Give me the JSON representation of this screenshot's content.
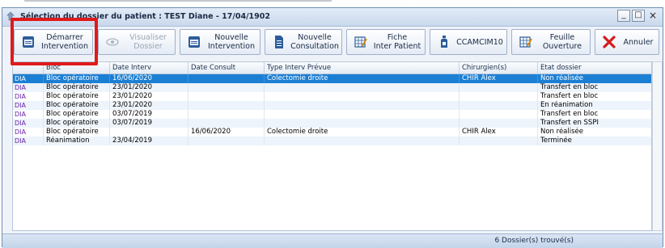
{
  "window": {
    "title": "Sélection du dossier du patient : TEST Diane - 17/04/1902",
    "minimize_label": "_",
    "maximize_label": "□",
    "close_label": "×"
  },
  "toolbar": {
    "buttons": [
      {
        "label": "Démarrer\nIntervention",
        "icon": "calendar-document-icon",
        "enabled": true
      },
      {
        "label": "Visualiser\nDossier",
        "icon": "eye-icon",
        "enabled": false
      },
      {
        "label": "Nouvelle\nIntervention",
        "icon": "calendar-document-icon",
        "enabled": true
      },
      {
        "label": "Nouvelle\nConsultation",
        "icon": "document-icon",
        "enabled": true
      },
      {
        "label": "Fiche\nInter Patient",
        "icon": "grid-pen-icon",
        "enabled": true
      },
      {
        "label": "CCAMCIM10",
        "icon": "bottle-icon",
        "enabled": true
      },
      {
        "label": "Feuille\nOuverture",
        "icon": "grid-pen-icon",
        "enabled": true
      },
      {
        "label": "Annuler",
        "icon": "red-x-icon",
        "enabled": true
      }
    ]
  },
  "table": {
    "columns": [
      "",
      "Bloc",
      "Date Interv",
      "Date Consult",
      "Type Interv Prévue",
      "Chirurgien(s)",
      "Etat dossier"
    ],
    "rows": [
      [
        "DIA",
        "Bloc opératoire",
        "16/06/2020",
        "",
        "Colectomie droite",
        "CHIR Alex",
        "Non réalisée"
      ],
      [
        "DIA",
        "Bloc opératoire",
        "23/01/2020",
        "",
        "",
        "",
        "Transfert en bloc"
      ],
      [
        "DIA",
        "Bloc opératoire",
        "23/01/2020",
        "",
        "",
        "",
        "Transfert en bloc"
      ],
      [
        "DIA",
        "Bloc opératoire",
        "23/01/2020",
        "",
        "",
        "",
        "En réanimation"
      ],
      [
        "DIA",
        "Bloc opératoire",
        "03/07/2019",
        "",
        "",
        "",
        "Transfert en bloc"
      ],
      [
        "DIA",
        "Bloc opératoire",
        "03/07/2019",
        "",
        "",
        "",
        "Transfert en SSPI"
      ],
      [
        "DIA",
        "Bloc opératoire",
        "",
        "16/06/2020",
        "Colectomie droite",
        "CHIR Alex",
        "Non réalisée"
      ],
      [
        "DIA",
        "Réanimation",
        "23/04/2019",
        "",
        "",
        "",
        "Terminée"
      ]
    ],
    "selected_row": 0
  },
  "status": {
    "text": "6 Dossier(s) trouvé(s)"
  },
  "colors": {
    "selection": "#1b7fd4",
    "highlight": "#e11a1a",
    "tag": "#6b1fa8"
  }
}
